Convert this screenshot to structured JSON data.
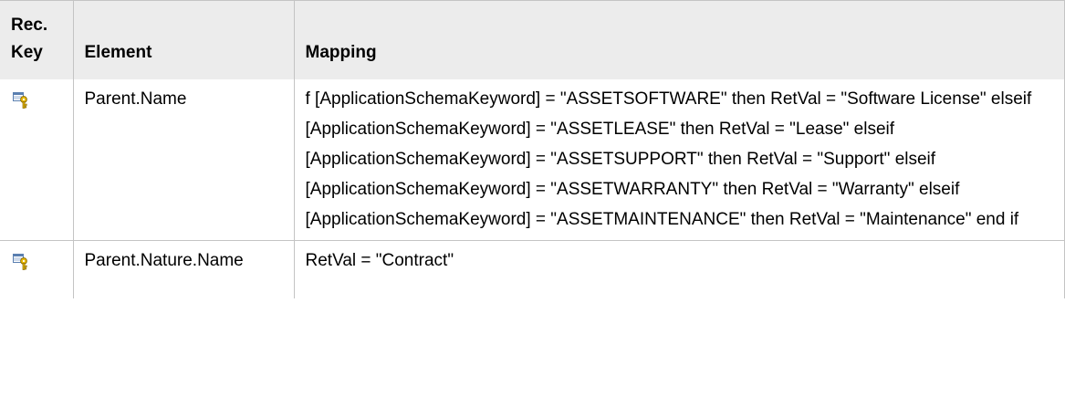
{
  "table": {
    "headers": {
      "rec_key": "Rec. Key",
      "element": "Element",
      "mapping": "Mapping"
    },
    "rows": [
      {
        "icon": "reconciliation-key-icon",
        "element": "Parent.Name",
        "mapping": "f [ApplicationSchemaKeyword] = \"ASSETSOFTWARE\" then RetVal = \"Software License\" elseif [ApplicationSchemaKeyword] = \"ASSETLEASE\" then RetVal = \"Lease\" elseif [ApplicationSchemaKeyword] = \"ASSETSUPPORT\" then RetVal = \"Support\" elseif [ApplicationSchemaKeyword] = \"ASSETWARRANTY\" then RetVal = \"Warranty\" elseif [ApplicationSchemaKeyword] = \"ASSETMAINTENANCE\" then RetVal = \"Maintenance\" end if"
      },
      {
        "icon": "reconciliation-key-icon",
        "element": "Parent.Nature.Name",
        "mapping": "RetVal = \"Contract\""
      }
    ]
  },
  "colors": {
    "header_background": "#ececec",
    "border": "#c4c4c4",
    "key_gold": "#d9a400",
    "key_table_blue": "#5a7fb0"
  }
}
